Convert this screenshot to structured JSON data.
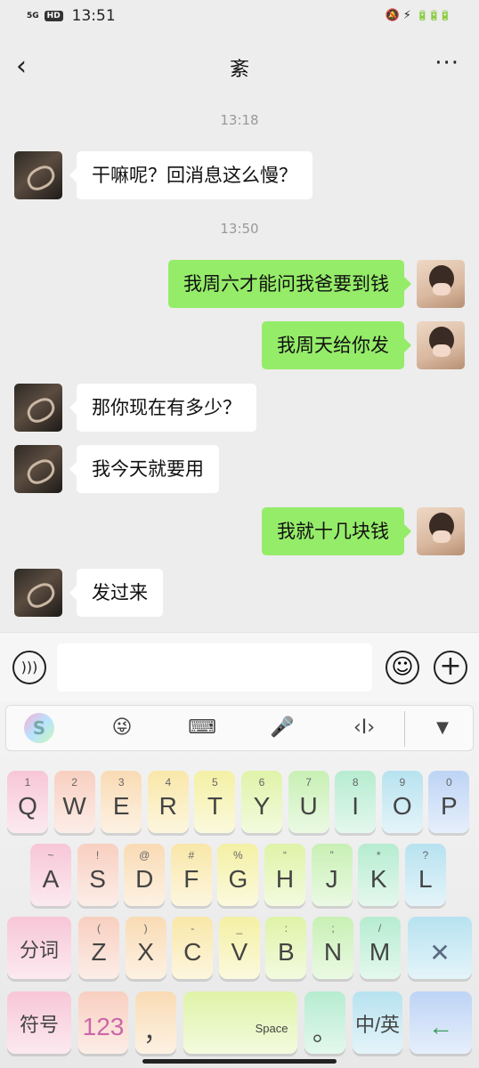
{
  "status_bar": {
    "signal": "5G",
    "hd": "HD",
    "time": "13:51",
    "icons": "🔕 ⚡",
    "battery": "🔋🔋🔋"
  },
  "nav": {
    "back_icon": "‹",
    "title": "紊",
    "more_icon": "···"
  },
  "timestamps": [
    "13:18",
    "13:50"
  ],
  "messages": [
    {
      "side": "left",
      "text": "干嘛呢？回消息这么慢？"
    },
    {
      "side": "right",
      "text": "我周六才能问我爸要到钱"
    },
    {
      "side": "right",
      "text": "我周天给你发"
    },
    {
      "side": "left",
      "text": "那你现在有多少？"
    },
    {
      "side": "left",
      "text": "我今天就要用"
    },
    {
      "side": "right",
      "text": "我就十几块钱"
    },
    {
      "side": "left",
      "text": "发过来"
    }
  ],
  "input": {
    "value": "",
    "placeholder": ""
  },
  "keyboard": {
    "toolbar": [
      "S",
      "😜",
      "⌨",
      "🎤",
      "‹I›",
      "▼"
    ],
    "row1": [
      {
        "k": "Q",
        "s": "1"
      },
      {
        "k": "W",
        "s": "2"
      },
      {
        "k": "E",
        "s": "3"
      },
      {
        "k": "R",
        "s": "4"
      },
      {
        "k": "T",
        "s": "5"
      },
      {
        "k": "Y",
        "s": "6"
      },
      {
        "k": "U",
        "s": "7"
      },
      {
        "k": "I",
        "s": "8"
      },
      {
        "k": "O",
        "s": "9"
      },
      {
        "k": "P",
        "s": "0"
      }
    ],
    "row2": [
      {
        "k": "A",
        "s": "~"
      },
      {
        "k": "S",
        "s": "!"
      },
      {
        "k": "D",
        "s": "@"
      },
      {
        "k": "F",
        "s": "#"
      },
      {
        "k": "G",
        "s": "%"
      },
      {
        "k": "H",
        "s": "“"
      },
      {
        "k": "J",
        "s": "”"
      },
      {
        "k": "K",
        "s": "*"
      },
      {
        "k": "L",
        "s": "?"
      }
    ],
    "row3": [
      {
        "k": "分词",
        "s": ""
      },
      {
        "k": "Z",
        "s": "("
      },
      {
        "k": "X",
        "s": ")"
      },
      {
        "k": "C",
        "s": "-"
      },
      {
        "k": "V",
        "s": "_"
      },
      {
        "k": "B",
        "s": ":"
      },
      {
        "k": "N",
        "s": ";"
      },
      {
        "k": "M",
        "s": "/"
      },
      {
        "k": "✕",
        "s": ""
      }
    ],
    "row4": [
      {
        "k": "符号",
        "s": ""
      },
      {
        "k": "123",
        "s": ""
      },
      {
        "k": "，",
        "s": ""
      },
      {
        "k": "Space",
        "s": ""
      },
      {
        "k": "。",
        "s": ""
      },
      {
        "k": "中/英",
        "s": ""
      },
      {
        "k": "←",
        "s": ""
      }
    ]
  }
}
